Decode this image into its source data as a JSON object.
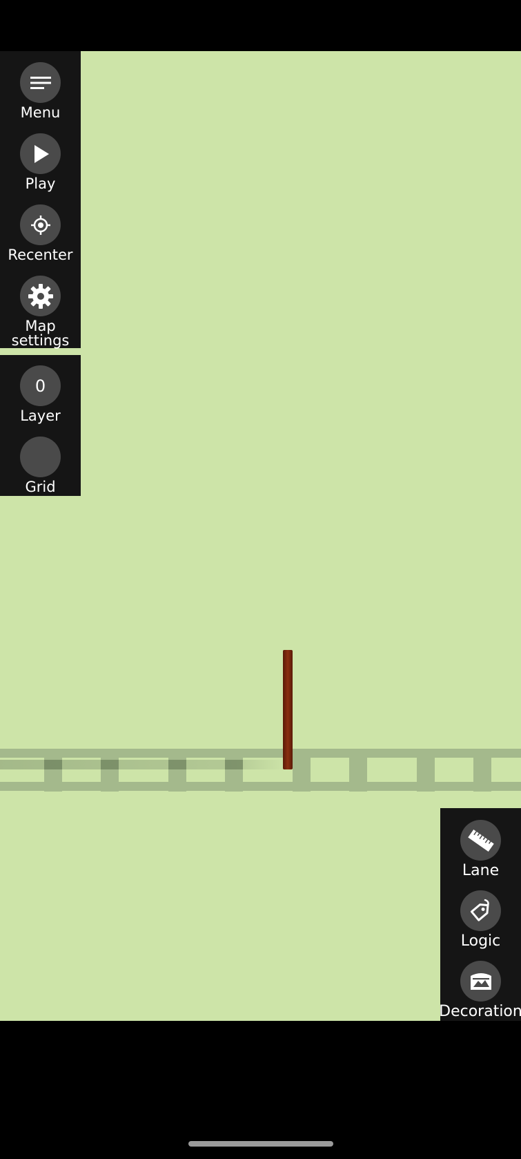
{
  "left_toolbar": {
    "menu_label": "Menu",
    "play_label": "Play",
    "recenter_label": "Recenter",
    "map_settings_label": "Map settings"
  },
  "left_toolbar_secondary": {
    "layer_value": "0",
    "layer_label": "Layer",
    "grid_label": "Grid"
  },
  "right_toolbar": {
    "lane_label": "Lane",
    "logic_label": "Logic",
    "decoration_label": "Decoration"
  },
  "colors": {
    "map_background": "#cde4a8",
    "panel_background": "#151515",
    "button_circle": "#4a4a4a",
    "track": "#a4b98c",
    "post": "#7a2a0e"
  },
  "icons": {
    "menu": "menu-lines-icon",
    "play": "play-triangle-icon",
    "recenter": "crosshair-icon",
    "map_settings": "gear-icon",
    "lane": "lane-ruler-icon",
    "logic": "logic-tag-icon",
    "decoration": "picture-icon"
  }
}
